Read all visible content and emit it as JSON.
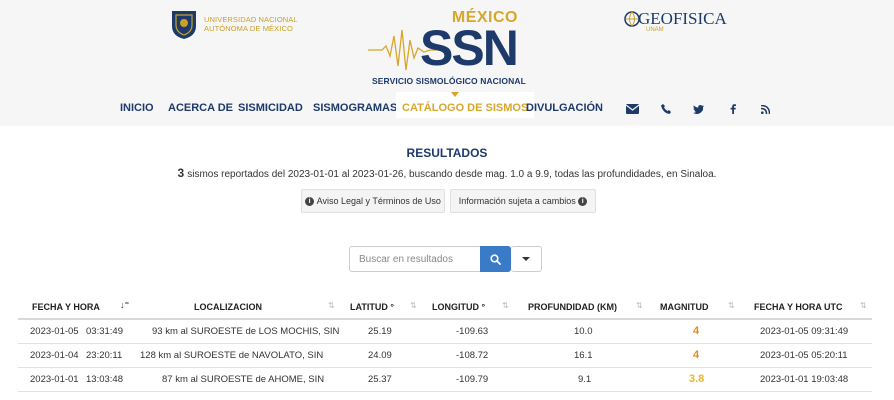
{
  "header": {
    "unam_line1": "UNIVERSIDAD NACIONAL",
    "unam_line2": "AUTÓNOMA DE MÉXICO",
    "ssn_country": "MÉXICO",
    "ssn_abbr": "SSN",
    "ssn_name": "SERVICIO SISMOLÓGICO NACIONAL",
    "geo_name": "GEOFISICA",
    "geo_sub": "UNAM"
  },
  "nav": {
    "items": [
      {
        "label": "INICIO"
      },
      {
        "label": "ACERCA DE"
      },
      {
        "label": "SISMICIDAD"
      },
      {
        "label": "SISMOGRAMAS"
      },
      {
        "label": "CATÁLOGO DE SISMOS"
      },
      {
        "label": "DIVULGACIÓN"
      }
    ],
    "active": "CATÁLOGO DE SISMOS",
    "icons": [
      "envelope-icon",
      "phone-icon",
      "twitter-icon",
      "facebook-icon",
      "rss-icon"
    ]
  },
  "results": {
    "title": "RESULTADOS",
    "count": "3",
    "summary": "sismos reportados del 2023-01-01 al 2023-01-26, buscando desde mag. 1.0 a 9.9, todas las profundidades, en Sinaloa.",
    "legal_button": "Aviso Legal y Términos de Uso",
    "info_button": "Información sujeta a cambios"
  },
  "search": {
    "placeholder": "Buscar en resultados"
  },
  "table": {
    "headers": {
      "fecha": "FECHA Y HORA",
      "localizacion": "LOCALIZACION",
      "latitud": "LATITUD °",
      "longitud": "LONGITUD °",
      "profundidad": "PROFUNDIDAD (KM)",
      "magnitud": "MAGNITUD",
      "utc": "FECHA Y HORA UTC"
    },
    "rows": [
      {
        "fecha": "2023-01-05",
        "hora": "03:31:49",
        "loc": "93 km al SUROESTE de LOS MOCHIS, SIN",
        "lat": "25.19",
        "lon": "-109.63",
        "prof": "10.0",
        "mag": "4",
        "mag_color": "#e88a1a",
        "utc": "2023-01-05  09:31:49"
      },
      {
        "fecha": "2023-01-04",
        "hora": "23:20:11",
        "loc": "128 km al SUROESTE de NAVOLATO, SIN",
        "lat": "24.09",
        "lon": "-108.72",
        "prof": "16.1",
        "mag": "4",
        "mag_color": "#e88a1a",
        "utc": "2023-01-05  05:20:11"
      },
      {
        "fecha": "2023-01-01",
        "hora": "13:03:48",
        "loc": "87 km al SUROESTE de AHOME, SIN",
        "lat": "25.37",
        "lon": "-109.79",
        "prof": "9.1",
        "mag": "3.8",
        "mag_color": "#f0b429",
        "utc": "2023-01-01  19:03:48"
      }
    ]
  }
}
